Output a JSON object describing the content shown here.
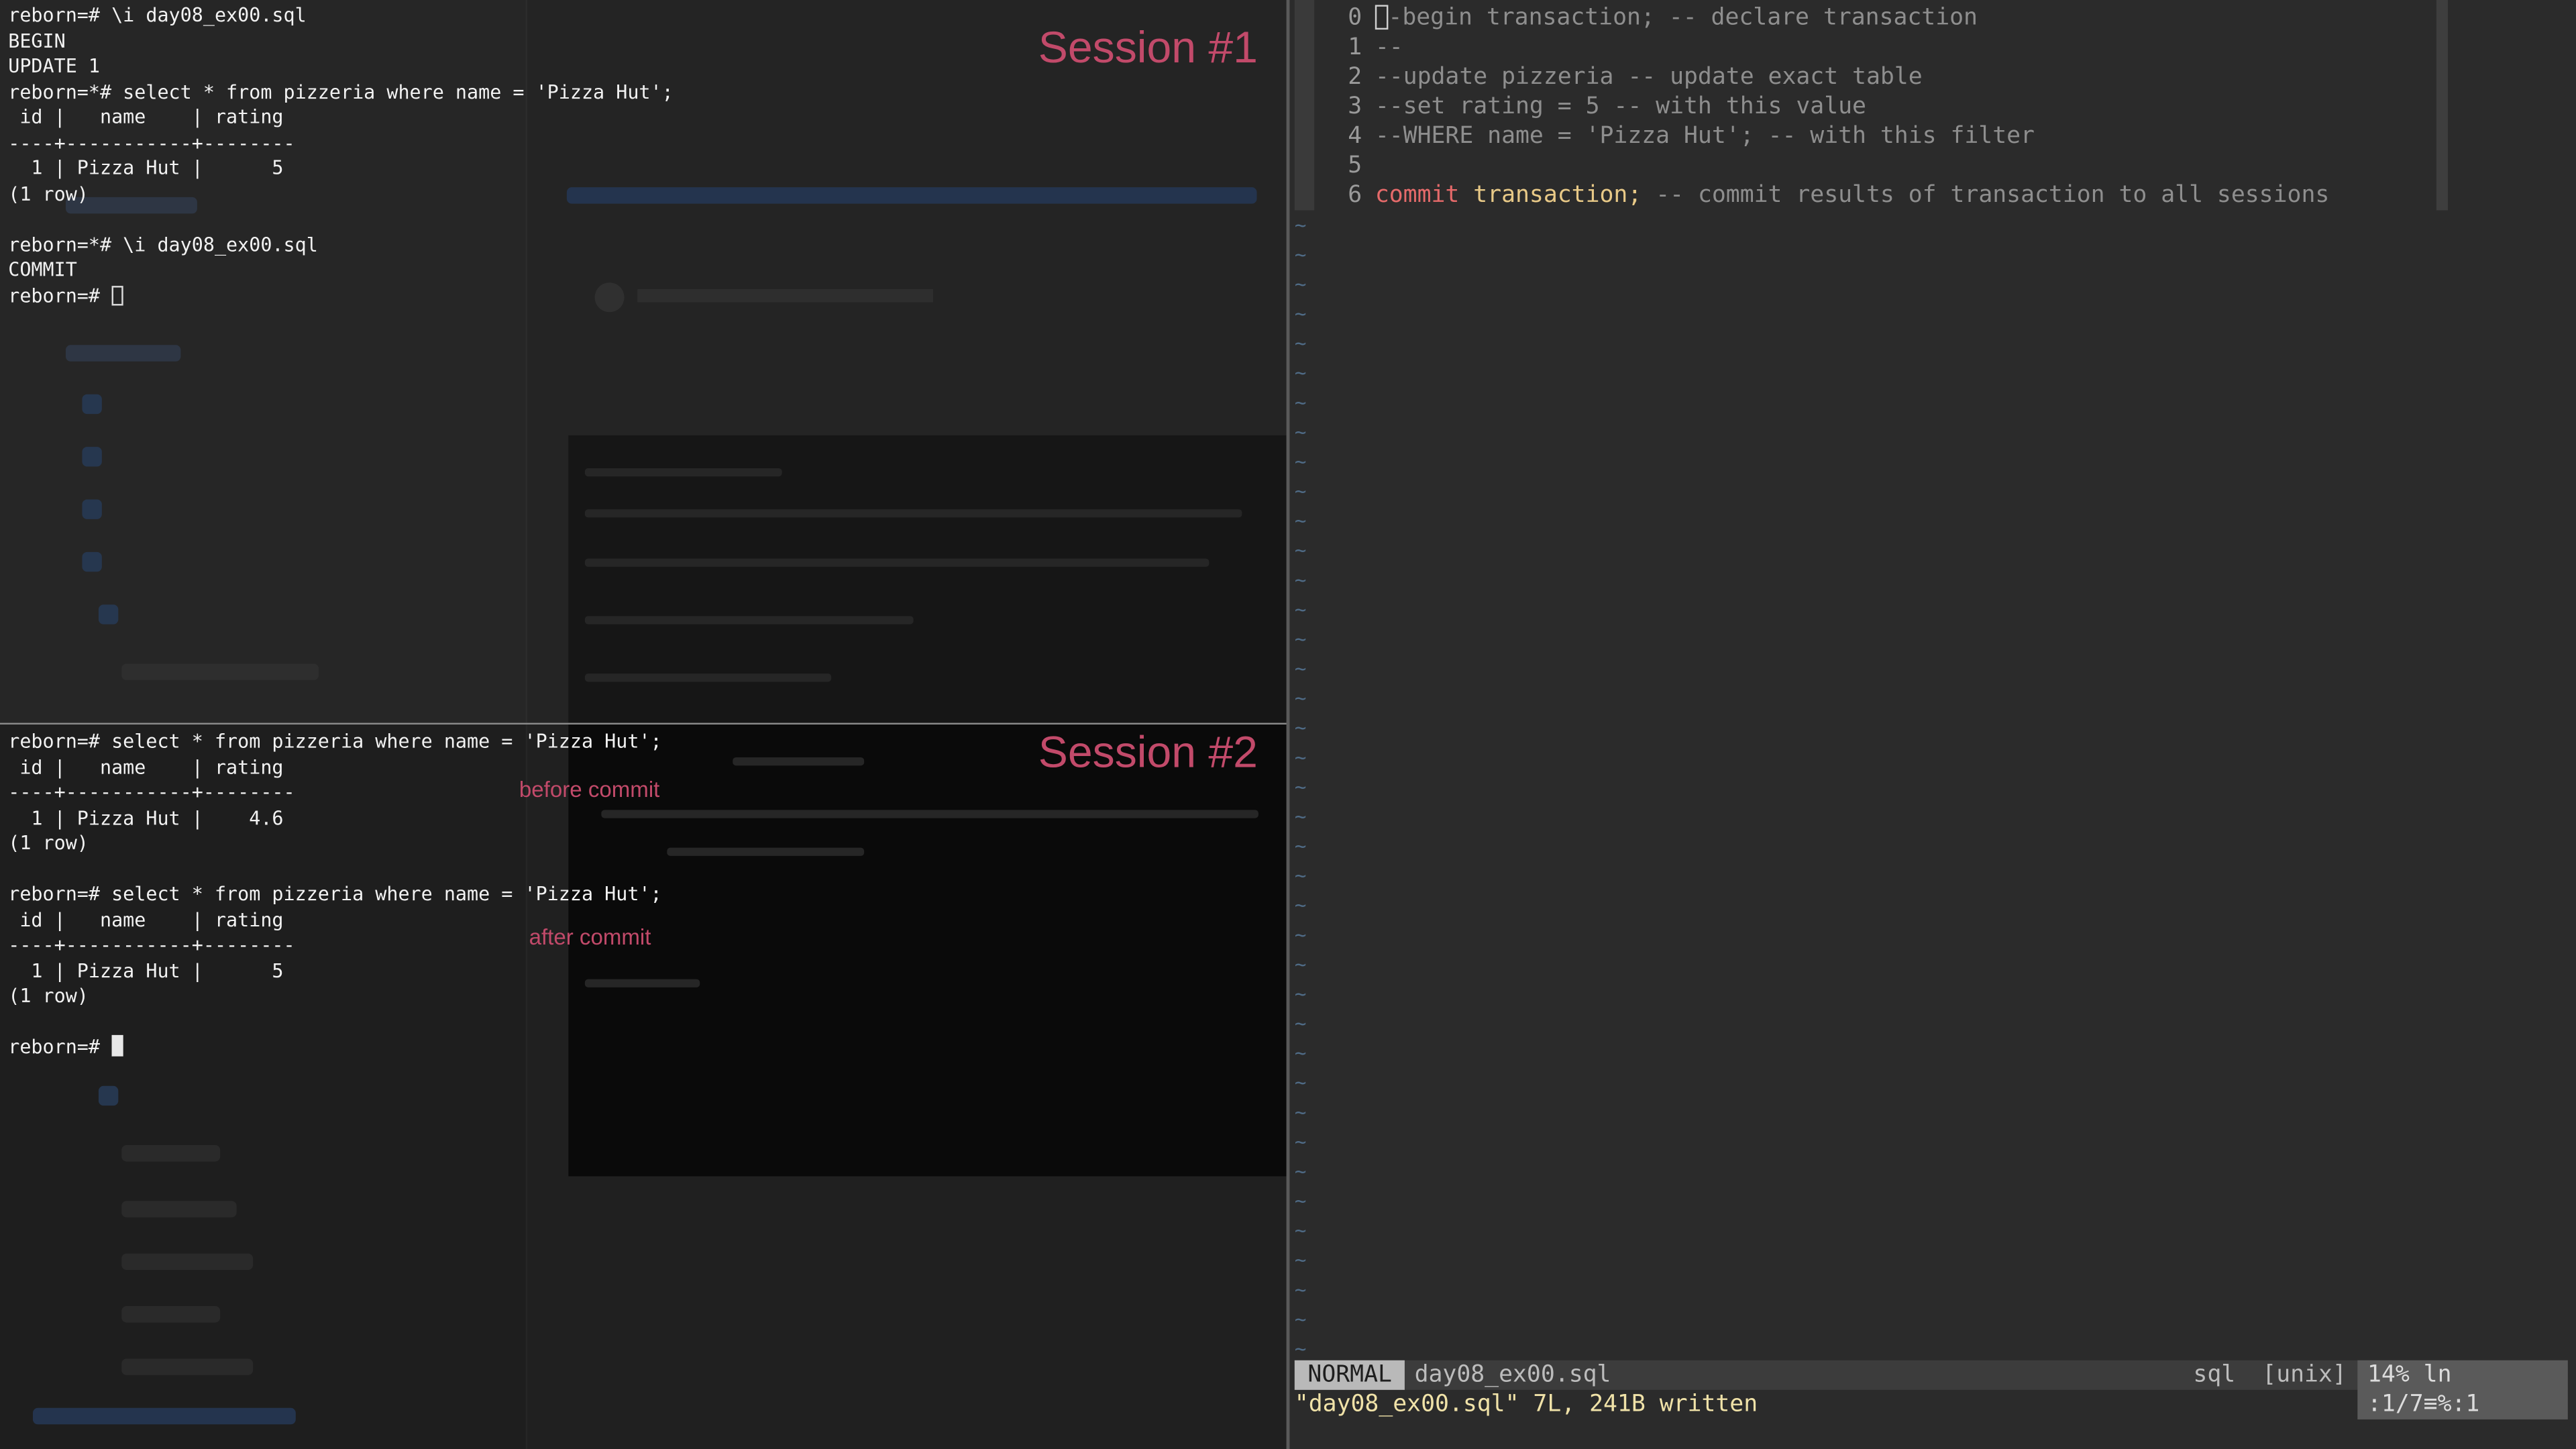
{
  "session1": {
    "label": "Session #1",
    "lines": [
      "reborn=# \\i day08_ex00.sql",
      "BEGIN",
      "UPDATE 1",
      "reborn=*# select * from pizzeria where name = 'Pizza Hut';",
      " id |   name    | rating",
      "----+-----------+--------",
      "  1 | Pizza Hut |      5",
      "(1 row)",
      "",
      "reborn=*# \\i day08_ex00.sql",
      "COMMIT"
    ],
    "prompt": "reborn=# "
  },
  "session2": {
    "label": "Session #2",
    "lines": [
      "reborn=# select * from pizzeria where name = 'Pizza Hut';",
      " id |   name    | rating",
      "----+-----------+--------",
      "  1 | Pizza Hut |    4.6",
      "(1 row)",
      "",
      "reborn=# select * from pizzeria where name = 'Pizza Hut';",
      " id |   name    | rating",
      "----+-----------+--------",
      "  1 | Pizza Hut |      5",
      "(1 row)",
      ""
    ],
    "prompt": "reborn=# ",
    "annotation_before": "before commit",
    "annotation_after": "after commit"
  },
  "vim": {
    "lines": [
      {
        "num": "0",
        "cursor_char": "-",
        "text": "-begin transaction; -- declare transaction"
      },
      {
        "num": "1",
        "text": "--"
      },
      {
        "num": "2",
        "text": "--update pizzeria -- update exact table"
      },
      {
        "num": "3",
        "text": "--set rating = 5 -- with this value"
      },
      {
        "num": "4",
        "text": "--WHERE name = 'Pizza Hut'; -- with this filter"
      },
      {
        "num": "5",
        "text": ""
      },
      {
        "num": "6",
        "kw": "commit",
        "rest": " transaction;",
        "comment": " -- commit results of transaction to all sessions"
      }
    ],
    "tilde": "~",
    "tilde_count": 39,
    "status": {
      "mode": "NORMAL",
      "file": "day08_ex00.sql",
      "filetype": "sql",
      "fileformat": "[unix]",
      "position": "14%  ln :1/7≡%:1"
    },
    "message": "\"day08_ex00.sql\" 7L, 241B written"
  }
}
